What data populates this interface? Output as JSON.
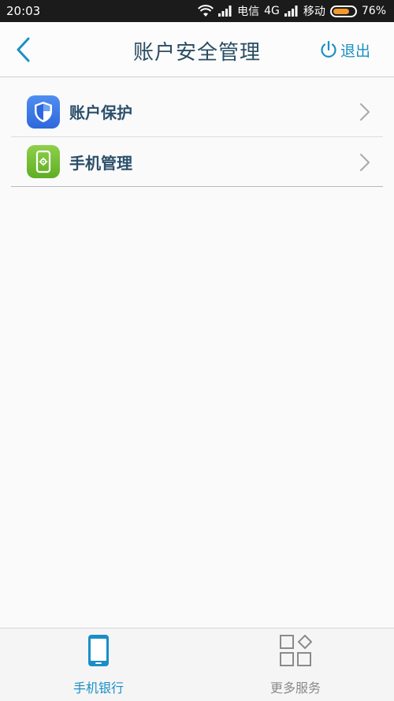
{
  "status_bar": {
    "time": "20:03",
    "carrier1": "电信",
    "network1": "4G",
    "carrier2": "移动",
    "battery": "76%",
    "battery_level": 0.76
  },
  "header": {
    "title": "账户安全管理",
    "logout_label": "退出",
    "back_icon": "chevron-left-icon",
    "logout_icon": "power-icon"
  },
  "menu": {
    "items": [
      {
        "label": "账户保护",
        "icon": "shield-icon",
        "color": "#3a7be6"
      },
      {
        "label": "手机管理",
        "icon": "phone-settings-icon",
        "color": "#74bf38"
      }
    ]
  },
  "tab_bar": {
    "tabs": [
      {
        "label": "手机银行",
        "icon": "mobile-phone-icon",
        "active": true
      },
      {
        "label": "更多服务",
        "icon": "grid-icon",
        "active": false
      }
    ]
  },
  "colors": {
    "accent": "#1a8fc5",
    "title": "#2a4d62",
    "inactive": "#8a8a8a"
  }
}
